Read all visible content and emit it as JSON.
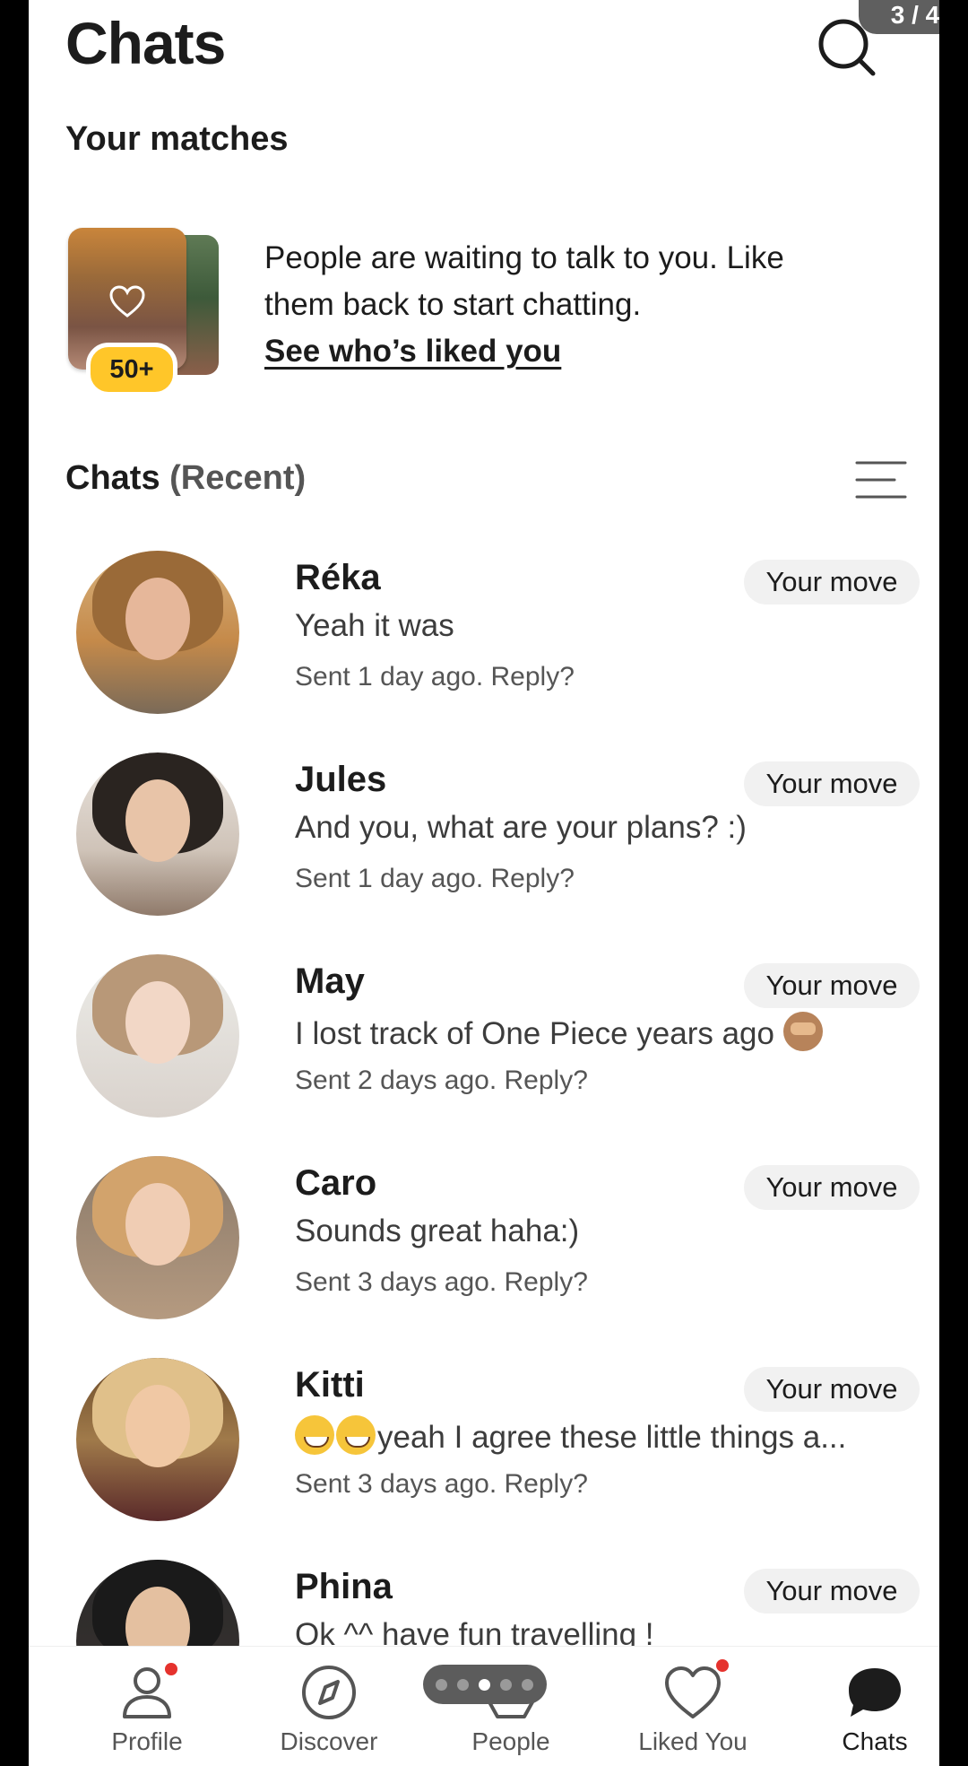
{
  "header": {
    "title": "Chats",
    "page_indicator": "3 / 4"
  },
  "matches": {
    "section_title": "Your matches",
    "badge_count": "50+",
    "promo_text": "People are waiting to talk to you. Like them back to start chatting.",
    "link_label": "See who’s liked you"
  },
  "chats": {
    "title": "Chats",
    "subtitle": "(Recent)",
    "items": [
      {
        "name": "Réka",
        "message": "Yeah it was",
        "time": "Sent 1 day ago. Reply?",
        "status": "Your move"
      },
      {
        "name": "Jules",
        "message": "And you, what are your plans? :)",
        "time": "Sent 1 day ago. Reply?",
        "status": "Your move"
      },
      {
        "name": "May",
        "message": "I lost track of One Piece years ago",
        "time": "Sent 2 days ago. Reply?",
        "status": "Your move"
      },
      {
        "name": "Caro",
        "message": "Sounds great haha:)",
        "time": "Sent 3 days ago. Reply?",
        "status": "Your move"
      },
      {
        "name": "Kitti",
        "message": "yeah I agree these little things a...",
        "time": "Sent 3 days ago. Reply?",
        "status": "Your move"
      },
      {
        "name": "Phina",
        "message": "Ok ^^ have fun travelling !",
        "time": "",
        "status": "Your move"
      }
    ]
  },
  "nav": {
    "profile": "Profile",
    "discover": "Discover",
    "people": "People",
    "liked_you": "Liked You",
    "chats": "Chats"
  },
  "colors": {
    "accent_badge": "#ffc629",
    "notification_dot": "#e5322d",
    "pill_background": "#f1f1f1"
  }
}
